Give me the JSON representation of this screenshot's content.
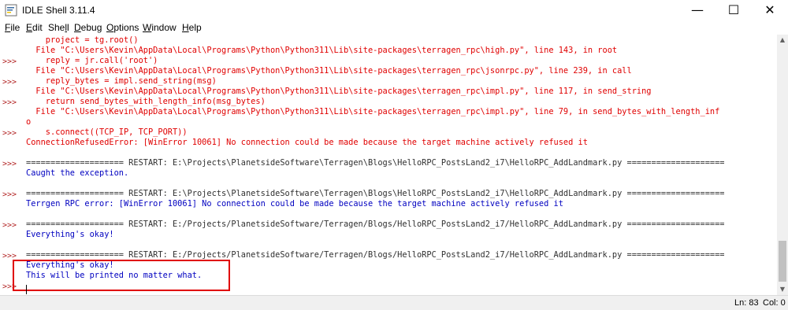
{
  "window": {
    "title": "IDLE Shell 3.11.4",
    "minimize_glyph": "—",
    "maximize_glyph": "☐",
    "close_glyph": "✕"
  },
  "menu": [
    {
      "first": "F",
      "rest": "ile"
    },
    {
      "first": "E",
      "rest": "dit"
    },
    {
      "pre": "She",
      "first": "l",
      "rest": "l"
    },
    {
      "first": "D",
      "rest": "ebug"
    },
    {
      "first": "O",
      "rest": "ptions"
    },
    {
      "first": "W",
      "rest": "indow"
    },
    {
      "first": "H",
      "rest": "elp"
    }
  ],
  "shell": {
    "lines": [
      {
        "text": "    project = tg.root()",
        "kind": "err"
      },
      {
        "text": "  File \"C:\\Users\\Kevin\\AppData\\Local\\Programs\\Python\\Python311\\Lib\\site-packages\\terragen_rpc\\high.py\", line 143, in root",
        "kind": "err"
      },
      {
        "text": "    reply = jr.call('root')",
        "kind": "err"
      },
      {
        "text": "  File \"C:\\Users\\Kevin\\AppData\\Local\\Programs\\Python\\Python311\\Lib\\site-packages\\terragen_rpc\\jsonrpc.py\", line 239, in call",
        "kind": "err"
      },
      {
        "text": "    reply_bytes = impl.send_string(msg)",
        "kind": "err"
      },
      {
        "text": "  File \"C:\\Users\\Kevin\\AppData\\Local\\Programs\\Python\\Python311\\Lib\\site-packages\\terragen_rpc\\impl.py\", line 117, in send_string",
        "kind": "err"
      },
      {
        "text": "    return send_bytes_with_length_info(msg_bytes)",
        "kind": "err"
      },
      {
        "text": "  File \"C:\\Users\\Kevin\\AppData\\Local\\Programs\\Python\\Python311\\Lib\\site-packages\\terragen_rpc\\impl.py\", line 79, in send_bytes_with_length_inf",
        "kind": "err"
      },
      {
        "text": "o",
        "kind": "err"
      },
      {
        "text": "    s.connect((TCP_IP, TCP_PORT))",
        "kind": "err"
      },
      {
        "text": "ConnectionRefusedError: [WinError 10061] No connection could be made because the target machine actively refused it",
        "kind": "err"
      },
      {
        "text": "",
        "kind": "sep"
      },
      {
        "text": "==================== RESTART: E:\\Projects\\PlanetsideSoftware\\Terragen\\Blogs\\HelloRPC_PostsLand2_i7\\HelloRPC_AddLandmark.py ====================",
        "kind": "sep"
      },
      {
        "text": "Caught the exception.",
        "kind": "out"
      },
      {
        "text": "",
        "kind": "sep"
      },
      {
        "text": "==================== RESTART: E:\\Projects\\PlanetsideSoftware\\Terragen\\Blogs\\HelloRPC_PostsLand2_i7\\HelloRPC_AddLandmark.py ====================",
        "kind": "sep"
      },
      {
        "text": "Terrgen RPC error: [WinError 10061] No connection could be made because the target machine actively refused it",
        "kind": "out"
      },
      {
        "text": "",
        "kind": "sep"
      },
      {
        "text": "==================== RESTART: E:/Projects/PlanetsideSoftware/Terragen/Blogs/HelloRPC_PostsLand2_i7/HelloRPC_AddLandmark.py ====================",
        "kind": "sep"
      },
      {
        "text": "Everything's okay!",
        "kind": "out"
      },
      {
        "text": "",
        "kind": "sep"
      },
      {
        "text": "==================== RESTART: E:/Projects/PlanetsideSoftware/Terragen/Blogs/HelloRPC_PostsLand2_i7/HelloRPC_AddLandmark.py ====================",
        "kind": "sep"
      },
      {
        "text": "Everything's okay!",
        "kind": "out"
      },
      {
        "text": "This will be printed no matter what.",
        "kind": "out"
      }
    ],
    "prompt": ">>>",
    "prompt_line_indices": [
      2,
      4,
      6,
      9,
      12,
      15,
      18,
      21,
      24
    ]
  },
  "status": {
    "line": "Ln: 83",
    "col": "Col: 0"
  },
  "colors": {
    "error": "#e00000",
    "output": "#0000c0",
    "prompt": "#b22222",
    "highlight_box": "#e00000"
  },
  "icons": {
    "app": "idle-python-icon"
  }
}
